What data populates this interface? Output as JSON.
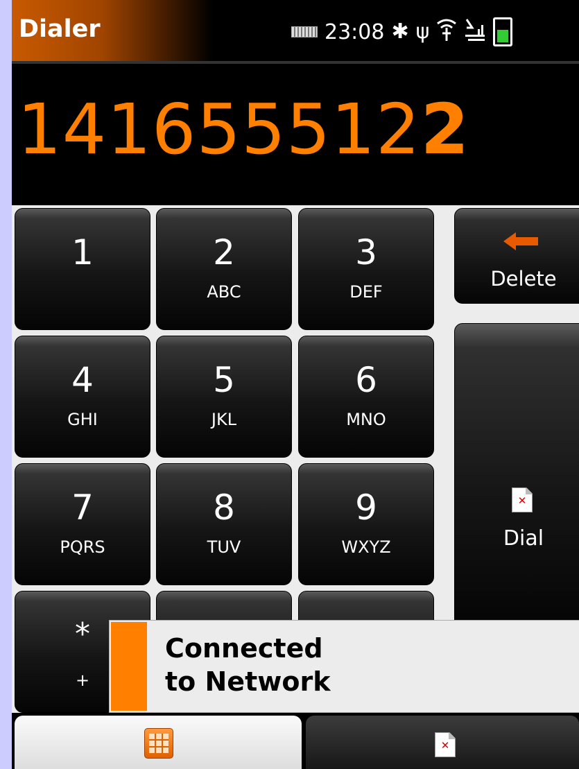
{
  "status_bar": {
    "app_title": "Dialer",
    "time": "23:08",
    "icons": [
      "keyboard-icon",
      "bluetooth-icon",
      "usb-icon",
      "wifi-icon",
      "signal-icon",
      "battery-icon"
    ]
  },
  "display": {
    "number_main": "141655512",
    "number_last": "2"
  },
  "keypad": {
    "keys": [
      {
        "digit": "1",
        "letters": ""
      },
      {
        "digit": "2",
        "letters": "ABC"
      },
      {
        "digit": "3",
        "letters": "DEF"
      },
      {
        "digit": "4",
        "letters": "GHI"
      },
      {
        "digit": "5",
        "letters": "JKL"
      },
      {
        "digit": "6",
        "letters": "MNO"
      },
      {
        "digit": "7",
        "letters": "PQRS"
      },
      {
        "digit": "8",
        "letters": "TUV"
      },
      {
        "digit": "9",
        "letters": "WXYZ"
      },
      {
        "digit": "*",
        "letters": "+"
      }
    ]
  },
  "actions": {
    "delete_label": "Delete",
    "dial_label": "Dial"
  },
  "notification": {
    "line1": "Connected",
    "line2": "to Network"
  },
  "colors": {
    "accent": "#ff7f00",
    "background": "#000000"
  }
}
